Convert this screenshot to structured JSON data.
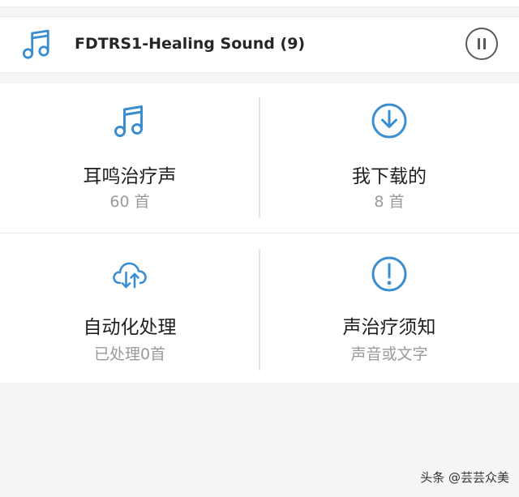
{
  "now_playing": {
    "icon": "music-note-icon",
    "title": "FDTRS1-Healing Sound (9)",
    "control_icon": "pause-icon"
  },
  "tiles": [
    {
      "icon": "music-note-icon",
      "label": "耳鸣治疗声",
      "sub": "60 首"
    },
    {
      "icon": "download-circle-icon",
      "label": "我下载的",
      "sub": "8 首"
    },
    {
      "icon": "cloud-sync-icon",
      "label": "自动化处理",
      "sub": "已处理0首"
    },
    {
      "icon": "exclamation-circle-icon",
      "label": "声治疗须知",
      "sub": "声音或文字"
    }
  ],
  "watermark": "头条 @芸芸众美",
  "colors": {
    "accent": "#3a8ed0",
    "label": "#1f1f1f",
    "sublabel": "#9a9a9a",
    "background": "#f5f5f5",
    "card": "#ffffff"
  }
}
